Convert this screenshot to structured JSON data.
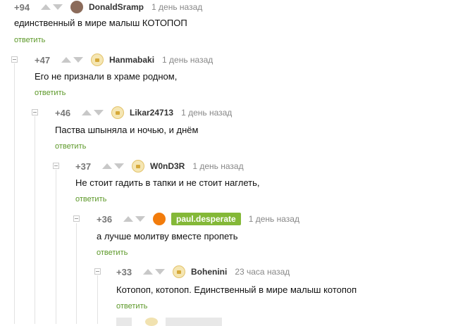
{
  "reply_label": "ответить",
  "comments": [
    {
      "rating": "+94",
      "author": "DonaldSramp",
      "time": "1 день назад",
      "text": "единственный в мире малыш КОТОПОП",
      "avatar": "photo-avatar"
    },
    {
      "rating": "+47",
      "author": "Hanmabaki",
      "time": "1 день назад",
      "text": "Его не признали в храме родном,",
      "avatar": "default-avatar"
    },
    {
      "rating": "+46",
      "author": "Likar24713",
      "time": "1 день назад",
      "text": "Паства шпыняла и ночью, и днём",
      "avatar": "default-avatar"
    },
    {
      "rating": "+37",
      "author": "W0nD3R",
      "time": "1 день назад",
      "text": "Не стоит гадить в тапки и не стоит наглеть,",
      "avatar": "default-avatar"
    },
    {
      "rating": "+36",
      "author": "paul.desperate",
      "time": "1 день назад",
      "text": "а лучше молитву вместе пропеть",
      "avatar": "orange-avatar"
    },
    {
      "rating": "+33",
      "author": "Bohenini",
      "time": "23 часа назад",
      "text": "Котопоп, котопоп. Единственный в мире малыш котопоп",
      "avatar": "default-avatar"
    }
  ],
  "colors": {
    "reply": "#5c9828",
    "author_badge": "#84b838",
    "orange_avatar": "#f27c0c"
  }
}
